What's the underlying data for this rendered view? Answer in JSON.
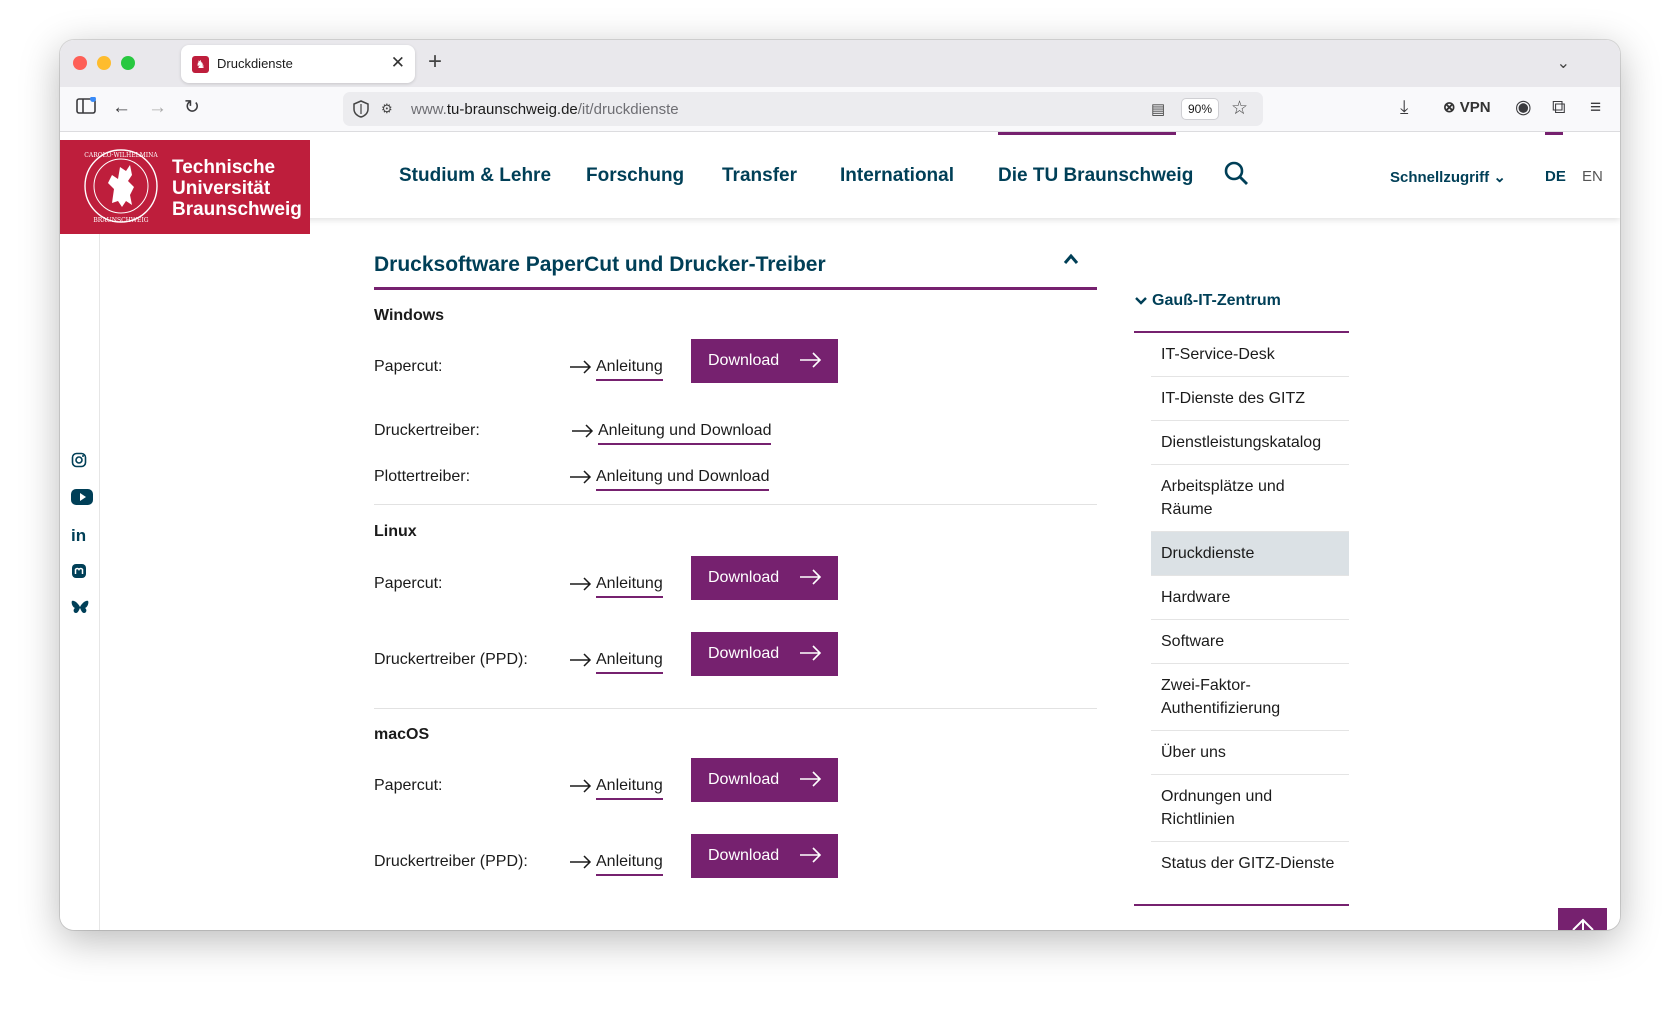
{
  "browser": {
    "tab_title": "Druckdienste",
    "tab_favicon": "tu-logo-icon",
    "url_prefix": "www.",
    "url_host": "tu-braunschweig.de",
    "url_path": "/it/druckdienste",
    "zoom": "90%",
    "vpn_label": "VPN"
  },
  "logo": {
    "line1": "Technische",
    "line2": "Universität",
    "line3": "Braunschweig",
    "seal_text": "CAROLO-WILHELMINA BRAUNSCHWEIG",
    "color": "#be1e3c"
  },
  "nav": {
    "items": [
      "Studium & Lehre",
      "Forschung",
      "Transfer",
      "International",
      "Die TU Braunschweig"
    ],
    "quick_access": "Schnellzugriff",
    "lang_de": "DE",
    "lang_en": "EN"
  },
  "social": [
    "instagram-icon",
    "youtube-icon",
    "linkedin-icon",
    "mastodon-icon",
    "bluesky-icon"
  ],
  "content": {
    "accordion_title": "Drucksoftware PaperCut und Drucker-Treiber",
    "windows": {
      "heading": "Windows",
      "papercut_label": "Papercut:",
      "papercut_link": "Anleitung",
      "papercut_btn": "Download",
      "driver_label": "Druckertreiber:",
      "driver_link": "Anleitung und Download",
      "plotter_label": "Plottertreiber:",
      "plotter_link": "Anleitung und Download"
    },
    "linux": {
      "heading": "Linux",
      "papercut_label": "Papercut:",
      "papercut_link": "Anleitung",
      "papercut_btn": "Download",
      "ppd_label": "Druckertreiber (PPD):",
      "ppd_link": "Anleitung",
      "ppd_btn": "Download"
    },
    "macos": {
      "heading": "macOS",
      "papercut_label": "Papercut:",
      "papercut_link": "Anleitung",
      "papercut_btn": "Download",
      "ppd_label": "Druckertreiber (PPD):",
      "ppd_link": "Anleitung",
      "ppd_btn": "Download"
    }
  },
  "side_nav": {
    "heading": "Gauß-IT-Zentrum",
    "items": [
      "IT-Service-Desk",
      "IT-Dienste des GITZ",
      "Dienstleistungskatalog",
      "Arbeitsplätze und Räume",
      "Druckdienste",
      "Hardware",
      "Software",
      "Zwei-Faktor-Authentifizierung",
      "Über uns",
      "Ordnungen und Richtlinien",
      "Status der GITZ-Dienste"
    ],
    "active_index": 4
  },
  "colors": {
    "accent": "#76216f",
    "nav_text": "#003f57",
    "brand_red": "#be1e3c"
  }
}
